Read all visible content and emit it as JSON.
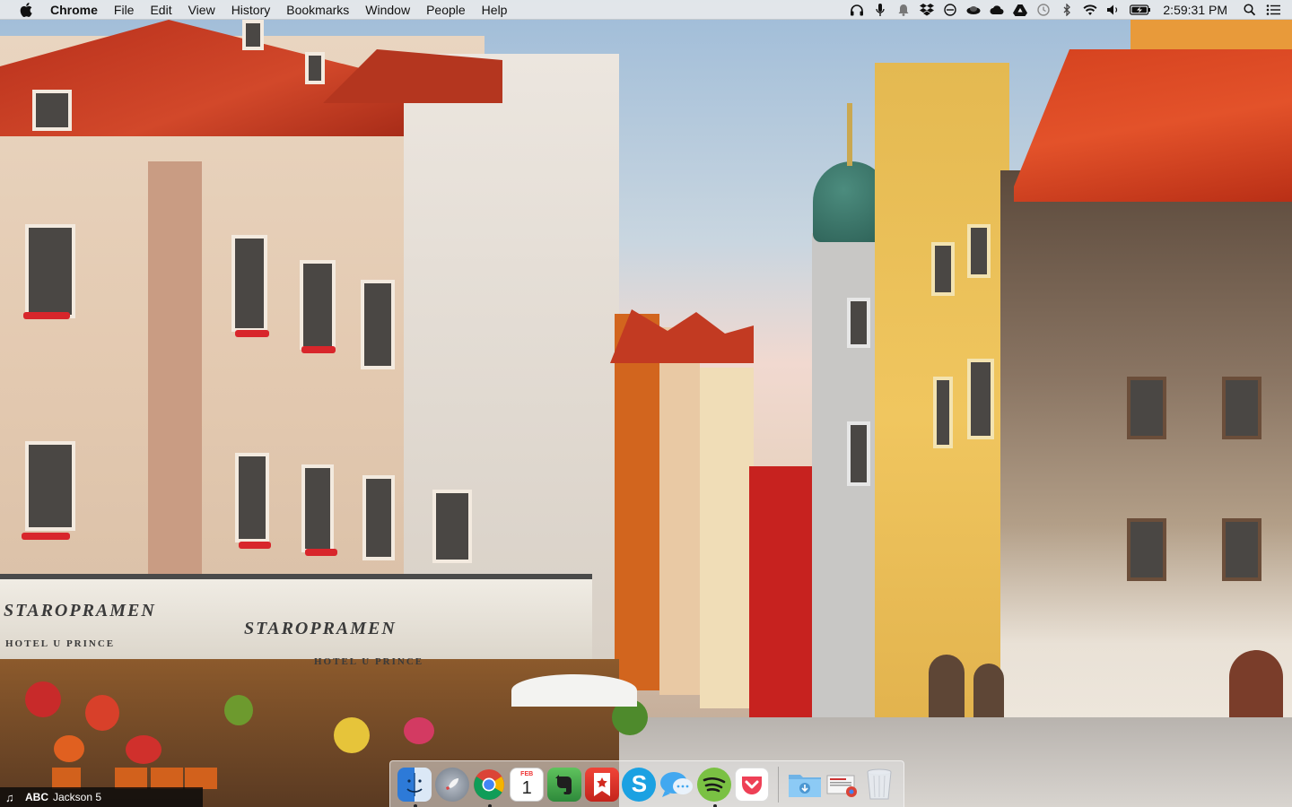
{
  "menubar": {
    "apple_icon": "apple-logo-icon",
    "app_name": "Chrome",
    "menus": [
      "File",
      "Edit",
      "View",
      "History",
      "Bookmarks",
      "Window",
      "People",
      "Help"
    ],
    "status_icons": [
      "headphones-icon",
      "microphone-icon",
      "notification-bell-icon",
      "dropbox-icon",
      "circle-slash-icon",
      "hat-icon",
      "cloud-icon",
      "google-drive-icon",
      "time-machine-icon",
      "bluetooth-icon",
      "wifi-icon",
      "volume-icon",
      "battery-charging-icon"
    ],
    "clock": "2:59:31 PM",
    "search_icon": "spotlight-search-icon",
    "notification_center_icon": "notification-center-icon"
  },
  "desktop": {
    "wallpaper": "prague-old-town-square",
    "awning_texts": [
      "STAROPRAMEN",
      "HOTEL U PRINCE",
      "HOTEL U PRINCE",
      "STAROPRAMEN"
    ]
  },
  "dock": {
    "apps": [
      {
        "name": "Finder",
        "icon": "finder-icon",
        "running": true,
        "color": "#3b8fe0"
      },
      {
        "name": "Launchpad",
        "icon": "rocket-icon",
        "running": false,
        "color": "#8c95a3"
      },
      {
        "name": "Google Chrome",
        "icon": "chrome-icon",
        "running": true,
        "color": "#ffffff"
      },
      {
        "name": "Calendar",
        "icon": "calendar-icon",
        "running": false,
        "color": "#ffffff",
        "month": "FEB",
        "day": "1"
      },
      {
        "name": "Evernote",
        "icon": "evernote-icon",
        "running": false,
        "color": "#3fa34d"
      },
      {
        "name": "Bookmark Star",
        "icon": "star-bookmark-icon",
        "running": false,
        "color": "#e0322b"
      },
      {
        "name": "Skype",
        "icon": "skype-icon",
        "running": false,
        "color": "#1ba1e2"
      },
      {
        "name": "Messages",
        "icon": "messages-icon",
        "running": false,
        "color": "#4fb3f5"
      },
      {
        "name": "Spotify",
        "icon": "spotify-icon",
        "running": true,
        "color": "#6cc04a"
      },
      {
        "name": "Pocket",
        "icon": "pocket-icon",
        "running": false,
        "color": "#ffffff"
      }
    ],
    "folders": [
      {
        "name": "Downloads",
        "icon": "downloads-folder-icon"
      },
      {
        "name": "Documents stack",
        "icon": "documents-stack-icon"
      },
      {
        "name": "Trash",
        "icon": "trash-icon"
      }
    ]
  },
  "nowplaying": {
    "icon": "music-note-icon",
    "station": "ABC",
    "track": "Jackson 5"
  }
}
